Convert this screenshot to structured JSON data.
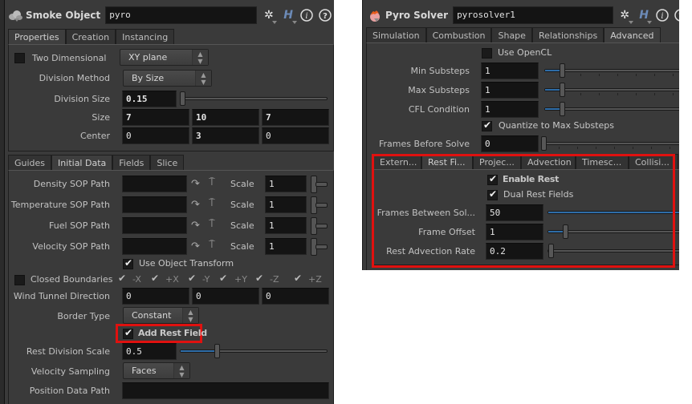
{
  "left_panel": {
    "node_type": "Smoke Object",
    "node_name": "pyro",
    "header_icons": [
      "gear-icon",
      "houdini-help-icon",
      "info-icon",
      "question-icon"
    ],
    "top_tabs": [
      {
        "label": "Properties",
        "active": true
      },
      {
        "label": "Creation",
        "active": false
      },
      {
        "label": "Instancing",
        "active": false
      }
    ],
    "properties": {
      "two_dimensional": {
        "label": "Two Dimensional",
        "checked": false,
        "plane": "XY plane"
      },
      "division_method": {
        "label": "Division Method",
        "value": "By Size"
      },
      "division_size": {
        "label": "Division Size",
        "value": "0.15"
      },
      "size": {
        "label": "Size",
        "values": [
          "7",
          "10",
          "7"
        ]
      },
      "center": {
        "label": "Center",
        "values": [
          "0",
          "3",
          "0"
        ]
      }
    },
    "bottom_tabs": [
      {
        "label": "Guides",
        "active": false
      },
      {
        "label": "Initial Data",
        "active": true
      },
      {
        "label": "Fields",
        "active": false
      },
      {
        "label": "Slice",
        "active": false
      }
    ],
    "initial_data": {
      "sop_paths": [
        {
          "label": "Density SOP Path",
          "value": "",
          "scale_label": "Scale",
          "scale": "1"
        },
        {
          "label": "Temperature SOP Path",
          "value": "",
          "scale_label": "Scale",
          "scale": "1"
        },
        {
          "label": "Fuel SOP Path",
          "value": "",
          "scale_label": "Scale",
          "scale": "1"
        },
        {
          "label": "Velocity SOP Path",
          "value": "",
          "scale_label": "Scale",
          "scale": "1"
        }
      ],
      "use_object_transform": {
        "label": "Use Object Transform",
        "checked": true
      },
      "closed_boundaries": {
        "label": "Closed Boundaries",
        "checked": false,
        "axes": [
          "-X",
          "+X",
          "-Y",
          "+Y",
          "-Z",
          "+Z"
        ]
      },
      "wind_tunnel_direction": {
        "label": "Wind Tunnel Direction",
        "values": [
          "0",
          "0",
          "0"
        ]
      },
      "border_type": {
        "label": "Border Type",
        "value": "Constant"
      },
      "add_rest_field": {
        "label": "Add Rest Field",
        "checked": true
      },
      "rest_division_scale": {
        "label": "Rest Division Scale",
        "value": "0.5"
      },
      "velocity_sampling": {
        "label": "Velocity Sampling",
        "value": "Faces"
      },
      "position_data_path": {
        "label": "Position Data Path",
        "value": ""
      }
    }
  },
  "right_panel": {
    "node_type": "Pyro Solver",
    "node_name": "pyrosolver1",
    "header_icons": [
      "gear-icon",
      "houdini-help-icon",
      "info-icon",
      "question-icon"
    ],
    "top_tabs": [
      {
        "label": "Simulation",
        "active": false
      },
      {
        "label": "Combustion",
        "active": false
      },
      {
        "label": "Shape",
        "active": false
      },
      {
        "label": "Relationships",
        "active": false
      },
      {
        "label": "Advanced",
        "active": true
      }
    ],
    "advanced": {
      "use_opencl": {
        "label": "Use OpenCL",
        "checked": false
      },
      "min_substeps": {
        "label": "Min Substeps",
        "value": "1"
      },
      "max_substeps": {
        "label": "Max Substeps",
        "value": "1"
      },
      "cfl_condition": {
        "label": "CFL Condition",
        "value": "1"
      },
      "quantize": {
        "label": "Quantize to Max Substeps",
        "checked": true
      },
      "frames_before_solve": {
        "label": "Frames Before Solve",
        "value": "0"
      }
    },
    "sub_tabs": [
      {
        "label": "Extern...",
        "active": false
      },
      {
        "label": "Rest Fi...",
        "active": true
      },
      {
        "label": "Projec...",
        "active": false
      },
      {
        "label": "Advection",
        "active": false
      },
      {
        "label": "Timesc...",
        "active": false
      },
      {
        "label": "Collisi...",
        "active": false
      }
    ],
    "rest_field": {
      "enable_rest": {
        "label": "Enable Rest",
        "checked": true
      },
      "dual_rest_fields": {
        "label": "Dual Rest Fields",
        "checked": true
      },
      "frames_between_solves": {
        "label": "Frames Between Sol...",
        "value": "50"
      },
      "frame_offset": {
        "label": "Frame Offset",
        "value": "1"
      },
      "rest_advection_rate": {
        "label": "Rest Advection Rate",
        "value": "0.2"
      }
    }
  },
  "highlight_color": "#e0110f",
  "accent_color": "#2e6da8"
}
